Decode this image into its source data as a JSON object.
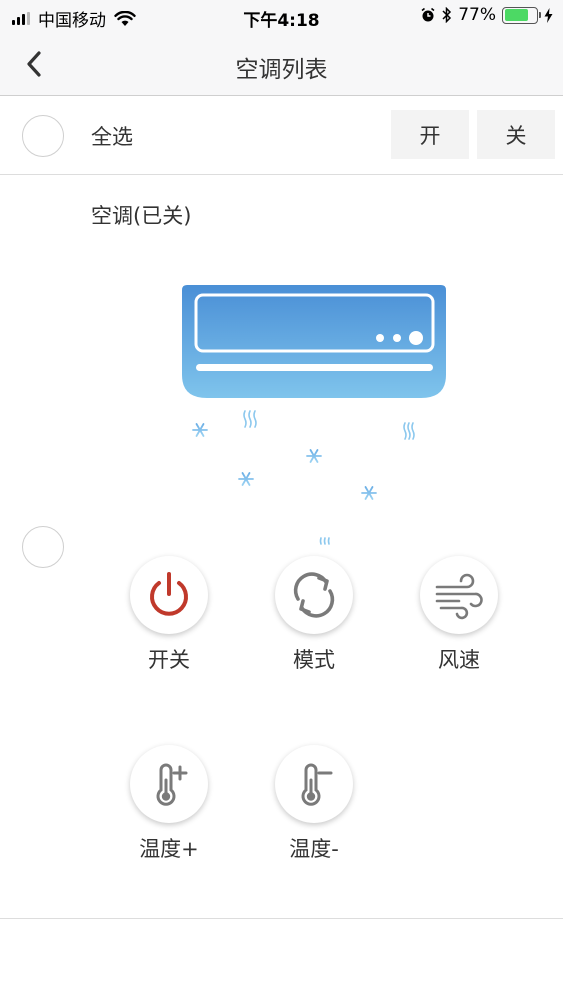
{
  "status_bar": {
    "carrier": "中国移动",
    "time": "下午4:18",
    "battery_percent": "77%",
    "battery_level": 0.77,
    "icons": [
      "signal-icon",
      "wifi-icon",
      "alarm-icon",
      "bluetooth-icon",
      "battery-icon",
      "charging-icon"
    ]
  },
  "nav": {
    "title": "空调列表",
    "back_icon": "chevron-left-icon"
  },
  "select_all": {
    "label": "全选",
    "on_label": "开",
    "off_label": "关"
  },
  "device": {
    "title": "空调(已关)",
    "image": "air-conditioner-illustration",
    "controls": [
      {
        "label": "开关",
        "icon": "power-icon"
      },
      {
        "label": "模式",
        "icon": "mode-cycle-icon"
      },
      {
        "label": "风速",
        "icon": "wind-icon"
      },
      {
        "label": "温度+",
        "icon": "thermometer-plus-icon"
      },
      {
        "label": "温度-",
        "icon": "thermometer-minus-icon"
      }
    ]
  },
  "colors": {
    "power_red": "#c0392b",
    "icon_gray": "#7a7a7a",
    "ac_blue_top": "#4a8fd6",
    "ac_blue_bottom": "#7fc4ec",
    "battery_green": "#4cd964"
  }
}
